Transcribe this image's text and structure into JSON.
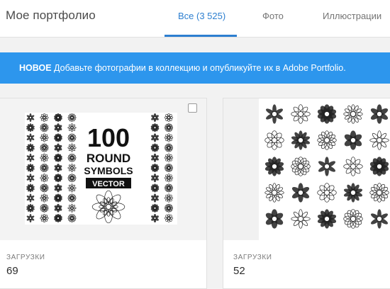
{
  "header": {
    "title": "Мое портфолио",
    "tabs": [
      {
        "label": "Все (3 525)",
        "active": true
      },
      {
        "label": "Фото",
        "active": false
      },
      {
        "label": "Иллюстрации",
        "active": false
      }
    ]
  },
  "banner": {
    "badge": "НОВОЕ",
    "text": "Добавьте фотографии в коллекцию и опубликуйте их в Adobe Portfolio."
  },
  "cards": [
    {
      "thumb_text": [
        "100",
        "ROUND",
        "SYMBOLS",
        "VECTOR"
      ],
      "stat_label": "ЗАГРУЗКИ",
      "stat_value": "69"
    },
    {
      "stat_label": "ЗАГРУЗКИ",
      "stat_value": "52"
    }
  ],
  "colors": {
    "accent": "#2d7fd0",
    "banner": "#2d96ed"
  }
}
